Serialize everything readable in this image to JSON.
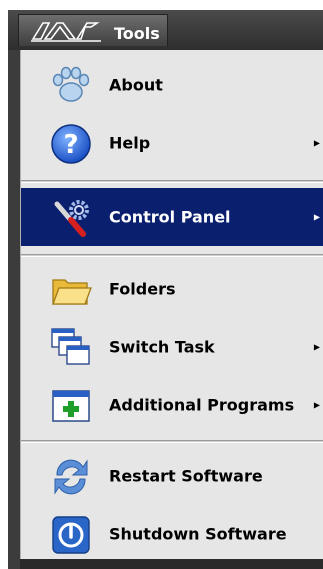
{
  "header": {
    "title": "Tools",
    "logo_icon": "avolites-logo"
  },
  "menu": {
    "items": [
      {
        "label": "About",
        "icon": "paw-icon",
        "has_submenu": false,
        "active": false
      },
      {
        "label": "Help",
        "icon": "help-icon",
        "has_submenu": true,
        "active": false
      },
      {
        "label": "Control Panel",
        "icon": "wrench-gear-icon",
        "has_submenu": true,
        "active": true
      },
      {
        "label": "Folders",
        "icon": "folder-icon",
        "has_submenu": false,
        "active": false
      },
      {
        "label": "Switch Task",
        "icon": "windows-icon",
        "has_submenu": true,
        "active": false
      },
      {
        "label": "Additional Programs",
        "icon": "add-window-icon",
        "has_submenu": true,
        "active": false
      },
      {
        "label": "Restart Software",
        "icon": "restart-icon",
        "has_submenu": false,
        "active": false
      },
      {
        "label": "Shutdown Software",
        "icon": "power-icon",
        "has_submenu": false,
        "active": false
      }
    ],
    "arrow_glyph": "▶"
  },
  "colors": {
    "highlight": "#0a1f6e",
    "menu_bg": "#e6e6e6",
    "titlebar": "#3c3c3c"
  }
}
